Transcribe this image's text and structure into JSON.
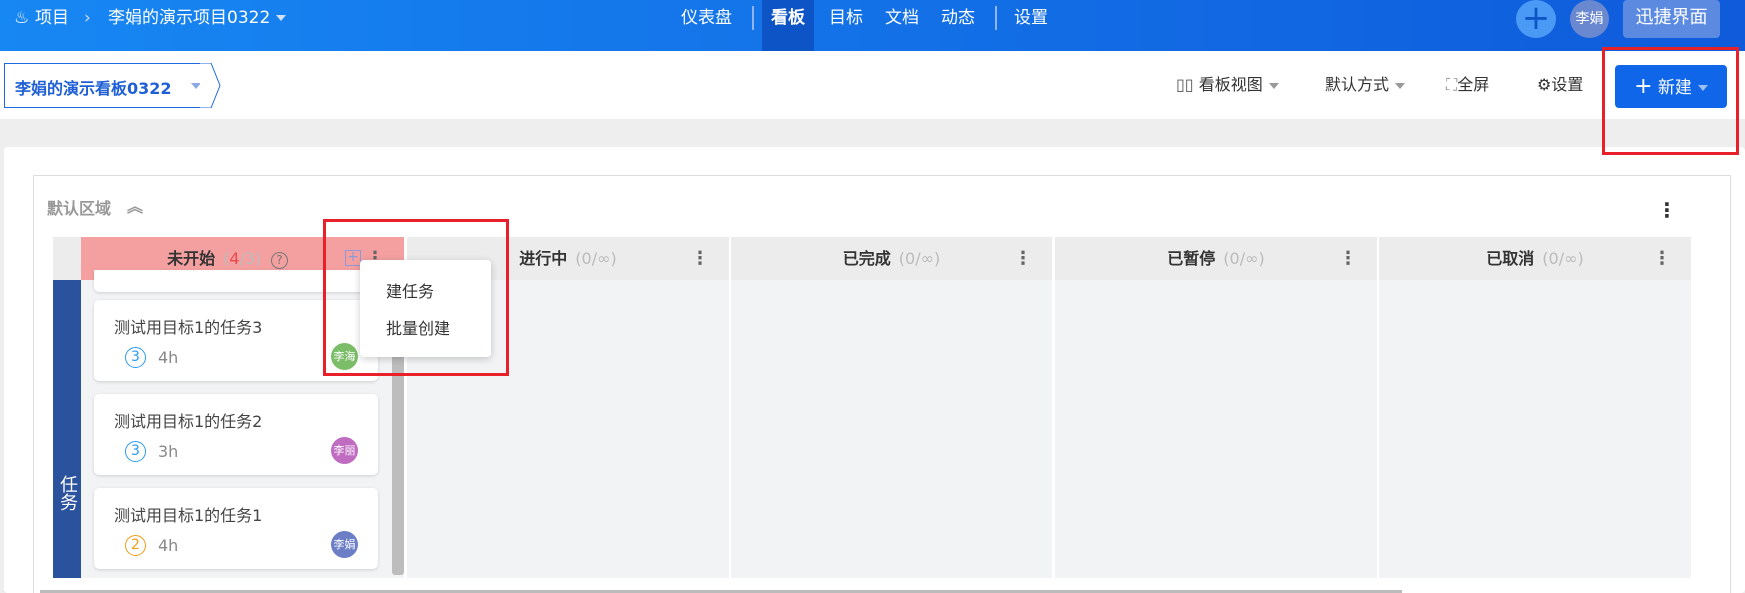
{
  "header": {
    "project_label": "项目",
    "project_name": "李娟的演示项目0322",
    "nav": [
      {
        "label": "仪表盘"
      },
      {
        "label": "看板",
        "active": true
      },
      {
        "label": "目标"
      },
      {
        "label": "文档"
      },
      {
        "label": "动态"
      },
      {
        "label": "设置"
      }
    ],
    "user": "李娟",
    "quick_ui": "迅捷界面"
  },
  "toolbar": {
    "board_name": "李娟的演示看板0322",
    "view": "看板视图",
    "sort": "默认方式",
    "fullscreen": "全屏",
    "settings": "设置",
    "new": "新建"
  },
  "region": {
    "title": "默认区域",
    "swimlane": "任务"
  },
  "columns": [
    {
      "name": "未开始",
      "count": "4",
      "limit": "3"
    },
    {
      "name": "进行中",
      "count": "0",
      "limit": "∞"
    },
    {
      "name": "已完成",
      "count": "0",
      "limit": "∞"
    },
    {
      "name": "已暂停",
      "count": "0",
      "limit": "∞"
    },
    {
      "name": "已取消",
      "count": "0",
      "limit": "∞"
    }
  ],
  "cards": [
    {
      "title": "测试用目标1的任务3",
      "points": "3",
      "hours": "4h",
      "assignee": "李海",
      "color": "#7cbd6a",
      "pcolor": "#2a9bf0"
    },
    {
      "title": "测试用目标1的任务2",
      "points": "3",
      "hours": "3h",
      "assignee": "李丽",
      "color": "#c06cc0",
      "pcolor": "#2a9bf0"
    },
    {
      "title": "测试用目标1的任务1",
      "points": "2",
      "hours": "4h",
      "assignee": "李娟",
      "color": "#6c7fc6",
      "pcolor": "#f39c12"
    }
  ],
  "popup": {
    "items": [
      "建任务",
      "批量创建"
    ]
  }
}
